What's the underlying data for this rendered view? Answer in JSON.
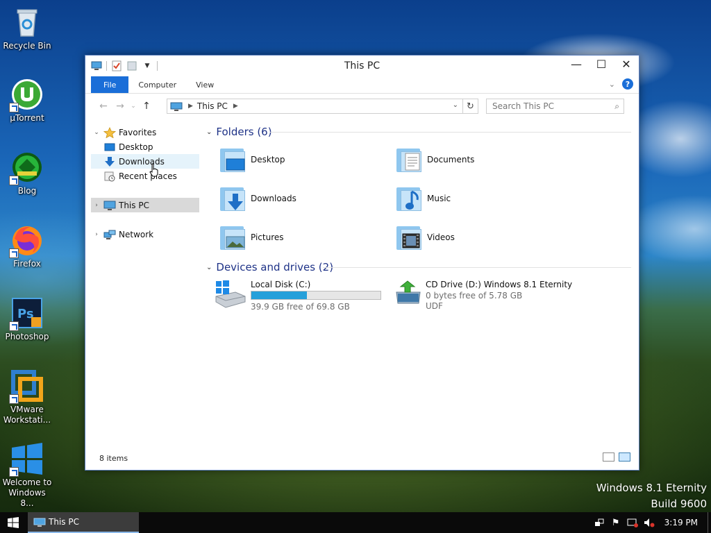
{
  "desktop": {
    "icons": [
      {
        "label": "Recycle Bin"
      },
      {
        "label": "µTorrent"
      },
      {
        "label": "Blog"
      },
      {
        "label": "Firefox"
      },
      {
        "label": "Photoshop"
      },
      {
        "label": "VMware Workstati..."
      },
      {
        "label": "Welcome to Windows 8..."
      }
    ],
    "watermark": {
      "line1": "Windows 8.1 Eternity",
      "line2": "Build 9600"
    }
  },
  "window": {
    "title": "This PC",
    "ribbon_tabs": [
      "File",
      "Computer",
      "View"
    ],
    "address": {
      "crumb": "This PC"
    },
    "search": {
      "placeholder": "Search This PC"
    },
    "nav_pane": {
      "favorites": "Favorites",
      "desktop": "Desktop",
      "downloads": "Downloads",
      "recent": "Recent places",
      "this_pc": "This PC",
      "network": "Network"
    },
    "folders": {
      "header": "Folders (6)",
      "items": [
        {
          "label": "Desktop"
        },
        {
          "label": "Documents"
        },
        {
          "label": "Downloads"
        },
        {
          "label": "Music"
        },
        {
          "label": "Pictures"
        },
        {
          "label": "Videos"
        }
      ]
    },
    "devices": {
      "header": "Devices and drives (2)",
      "drives": [
        {
          "name": "Local Disk (C:)",
          "free": "39.9 GB free of 69.8 GB",
          "used_fraction": 0.43
        },
        {
          "name": "CD Drive (D:) Windows 8.1 Eternity",
          "free": "0 bytes free of 5.78 GB",
          "fs": "UDF"
        }
      ]
    },
    "status": "8 items"
  },
  "taskbar": {
    "task_label": "This PC",
    "clock": "3:19 PM"
  },
  "colors": {
    "accent": "#1a6ed8",
    "group_header": "#1e3287",
    "drive_bar": "#26a0da"
  }
}
